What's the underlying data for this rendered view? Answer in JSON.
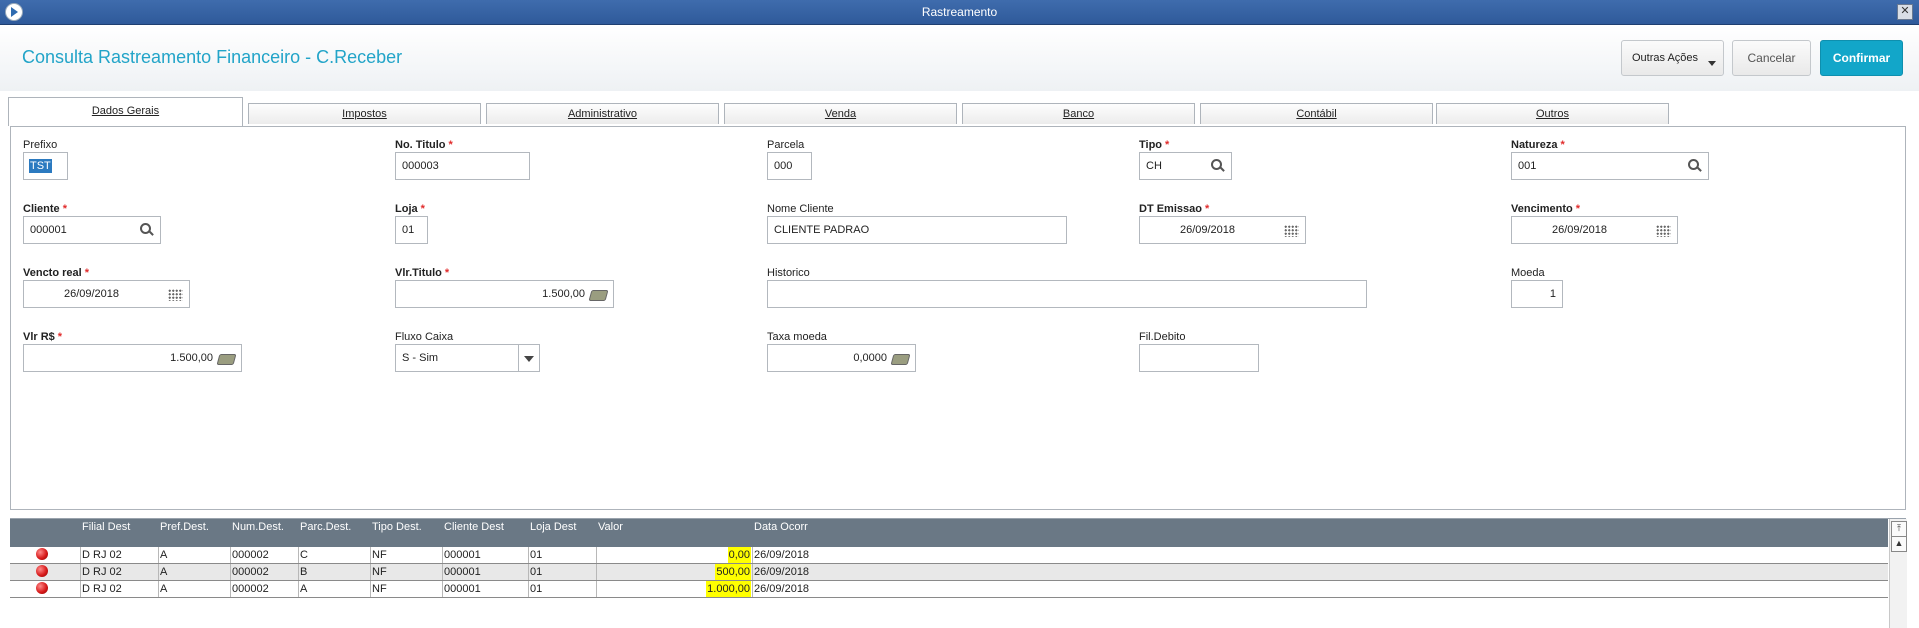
{
  "window": {
    "title": "Rastreamento"
  },
  "header": {
    "page_title": "Consulta Rastreamento Financeiro - C.Receber",
    "more_actions_label": "Outras Ações",
    "cancel_label": "Cancelar",
    "confirm_label": "Confirmar"
  },
  "tabs": [
    "Dados Gerais",
    "Impostos",
    "Administrativo",
    "Venda",
    "Banco",
    "Contábil",
    "Outros"
  ],
  "active_tab": "Dados Gerais",
  "form": {
    "prefixo": {
      "label": "Prefixo",
      "value": "TST"
    },
    "no_titulo": {
      "label": "No. Titulo",
      "value": "000003"
    },
    "parcela": {
      "label": "Parcela",
      "value": "000"
    },
    "tipo": {
      "label": "Tipo",
      "value": "CH"
    },
    "natureza": {
      "label": "Natureza",
      "value": "001"
    },
    "cliente": {
      "label": "Cliente",
      "value": "000001"
    },
    "loja": {
      "label": "Loja",
      "value": "01"
    },
    "nome_cliente": {
      "label": "Nome Cliente",
      "value": "CLIENTE PADRAO"
    },
    "dt_emissao": {
      "label": "DT Emissao",
      "value": "26/09/2018"
    },
    "vencimento": {
      "label": "Vencimento",
      "value": "26/09/2018"
    },
    "vencto_real": {
      "label": "Vencto real",
      "value": "26/09/2018"
    },
    "vlr_titulo": {
      "label": "Vlr.Titulo",
      "value": "1.500,00"
    },
    "historico": {
      "label": "Historico",
      "value": ""
    },
    "moeda": {
      "label": "Moeda",
      "value": "1"
    },
    "vlr_rs": {
      "label": "Vlr R$",
      "value": "1.500,00"
    },
    "fluxo_caixa": {
      "label": "Fluxo Caixa",
      "value": "S - Sim"
    },
    "taxa_moeda": {
      "label": "Taxa moeda",
      "value": "0,0000"
    },
    "fil_debito": {
      "label": "Fil.Debito",
      "value": ""
    }
  },
  "required_marker": "*",
  "grid": {
    "columns": [
      "Filial Dest",
      "Pref.Dest.",
      "Num.Dest.",
      "Parc.Dest.",
      "Tipo Dest.",
      "Cliente Dest",
      "Loja Dest",
      "Valor",
      "Data Ocorr"
    ],
    "rows": [
      {
        "status": "red",
        "filial": "D RJ 02",
        "pref": "A",
        "num": "000002",
        "parc": "C",
        "tipo": "NF",
        "cliente": "000001",
        "loja": "01",
        "valor": "0,00",
        "data": "26/09/2018"
      },
      {
        "status": "red",
        "filial": "D RJ 02",
        "pref": "A",
        "num": "000002",
        "parc": "B",
        "tipo": "NF",
        "cliente": "000001",
        "loja": "01",
        "valor": "500,00",
        "data": "26/09/2018"
      },
      {
        "status": "red",
        "filial": "D RJ 02",
        "pref": "A",
        "num": "000002",
        "parc": "A",
        "tipo": "NF",
        "cliente": "000001",
        "loja": "01",
        "valor": "1.000,00",
        "data": "26/09/2018"
      }
    ]
  },
  "colors": {
    "accent": "#22a4c8",
    "confirm": "#12a6c9",
    "required": "#e12b2b",
    "value_highlight": "#ffff00",
    "grid_header": "#6a7885",
    "titlebar": "#3a66a8"
  },
  "icons": [
    "app-icon",
    "close-icon",
    "search-icon",
    "calendar-icon",
    "money-icon",
    "chevron-down-icon",
    "status-red-icon",
    "scroll-top-icon",
    "scroll-up-icon"
  ]
}
